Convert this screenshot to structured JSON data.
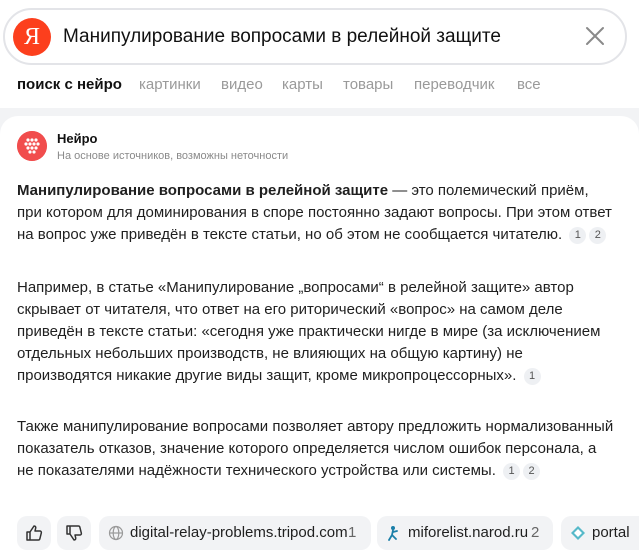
{
  "search": {
    "logo_letter": "Я",
    "query": "Манипулирование вопросами в релейной защите"
  },
  "tabs": [
    {
      "label": "поиск с нейро",
      "active": true
    },
    {
      "label": "картинки",
      "active": false
    },
    {
      "label": "видео",
      "active": false
    },
    {
      "label": "карты",
      "active": false
    },
    {
      "label": "товары",
      "active": false
    },
    {
      "label": "переводчик",
      "active": false
    },
    {
      "label": "все",
      "active": false
    }
  ],
  "neiro": {
    "name": "Нейро",
    "subtitle": "На основе источников, возможны неточности"
  },
  "answer": {
    "p1_bold": "Манипулирование вопросами в релейной защите",
    "p1_text": " — это полемический приём, при котором для доминирования в споре постоянно задают вопросы. При этом ответ на вопрос уже приведён в тексте статьи, но об этом не сообщается читателю.",
    "p1_refs": [
      "1",
      "2"
    ],
    "p2_text": "Например, в статье «Манипулирование „вопросами“ в релейной защите» автор скрывает от читателя, что ответ на его риторический «вопрос» на самом деле приведён в тексте статьи: «сегодня уже практически нигде в мире (за исключением отдельных небольших производств, не влияющих на общую картину) не производятся никакие другие виды защит, кроме микропроцессорных».",
    "p2_refs": [
      "1"
    ],
    "p3_text": "Также манипулирование вопросами позволяет автору предложить нормализованный показатель отказов, значение которого определяется числом ошибок персонала, а не показателями надёжности технического устройства или системы.",
    "p3_refs": [
      "1",
      "2"
    ]
  },
  "sources": [
    {
      "label": "digital-relay-problems.tripod.com",
      "count": "1",
      "icon": "globe-icon"
    },
    {
      "label": "miforelist.narod.ru",
      "count": "2",
      "icon": "narod-icon"
    },
    {
      "label": "portal",
      "count": "",
      "icon": "portal-icon"
    }
  ],
  "colors": {
    "brand": "#fc3f1d",
    "neiro": "#f14d4d",
    "chip_bg": "#f2f3f5"
  }
}
